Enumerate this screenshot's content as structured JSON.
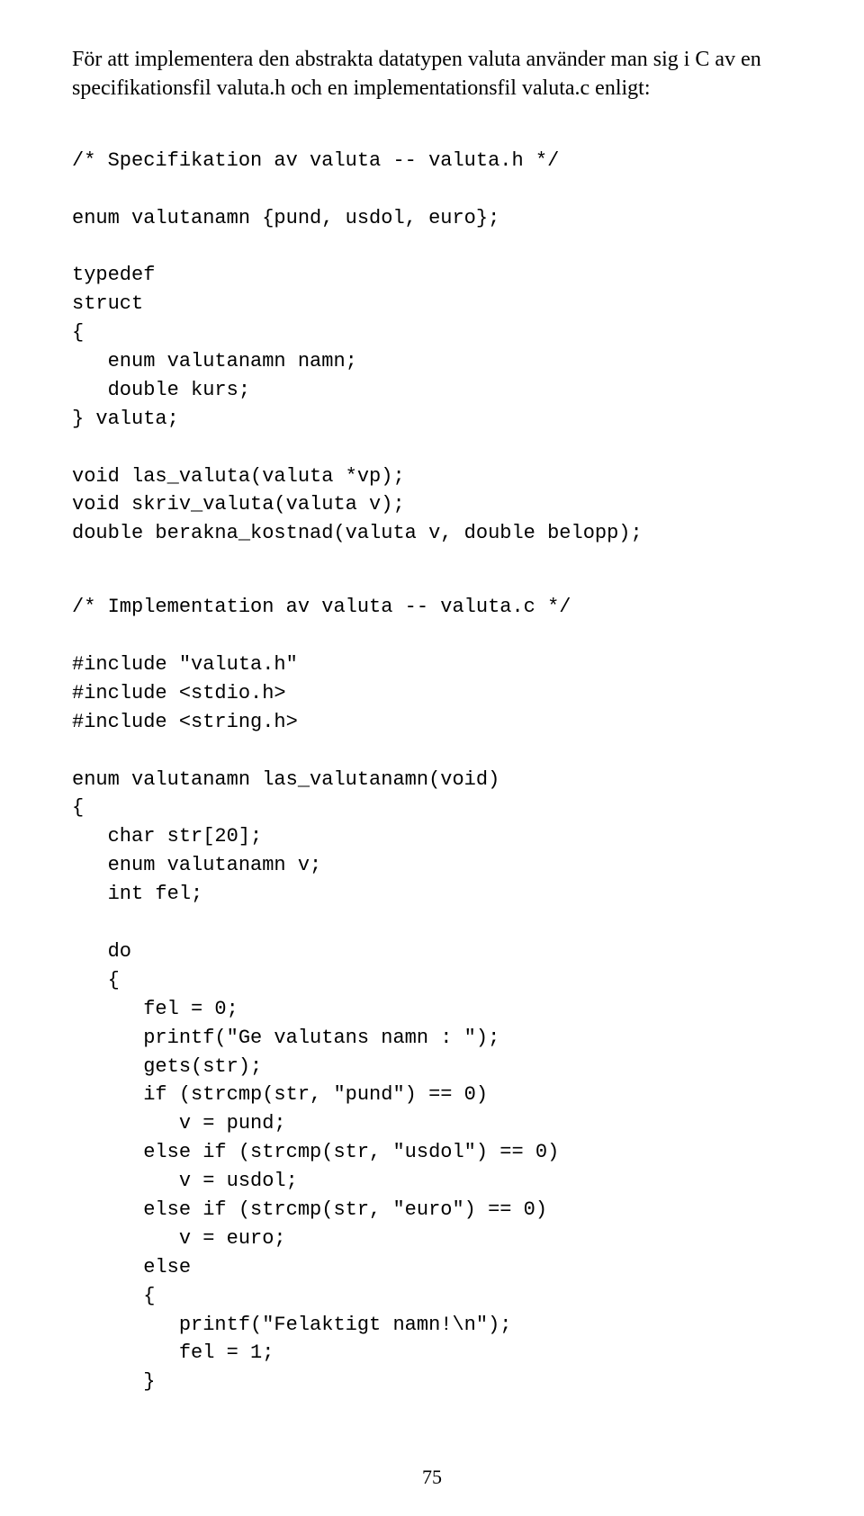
{
  "intro": "För att implementera den abstrakta datatypen valuta använder man sig i C av en specifikationsfil valuta.h och en implementationsfil valuta.c enligt:",
  "code": {
    "block1": "/* Specifikation av valuta -- valuta.h */\n\nenum valutanamn {pund, usdol, euro};\n\ntypedef\nstruct\n{\n   enum valutanamn namn;\n   double kurs;\n} valuta;\n\nvoid las_valuta(valuta *vp);\nvoid skriv_valuta(valuta v);\ndouble berakna_kostnad(valuta v, double belopp);",
    "block2": "/* Implementation av valuta -- valuta.c */\n\n#include \"valuta.h\"\n#include <stdio.h>\n#include <string.h>\n\nenum valutanamn las_valutanamn(void)\n{\n   char str[20];\n   enum valutanamn v;\n   int fel;\n\n   do\n   {\n      fel = 0;\n      printf(\"Ge valutans namn : \");\n      gets(str);\n      if (strcmp(str, \"pund\") == 0)\n         v = pund;\n      else if (strcmp(str, \"usdol\") == 0)\n         v = usdol;\n      else if (strcmp(str, \"euro\") == 0)\n         v = euro;\n      else\n      {\n         printf(\"Felaktigt namn!\\n\");\n         fel = 1;\n      }"
  },
  "page_number": "75"
}
